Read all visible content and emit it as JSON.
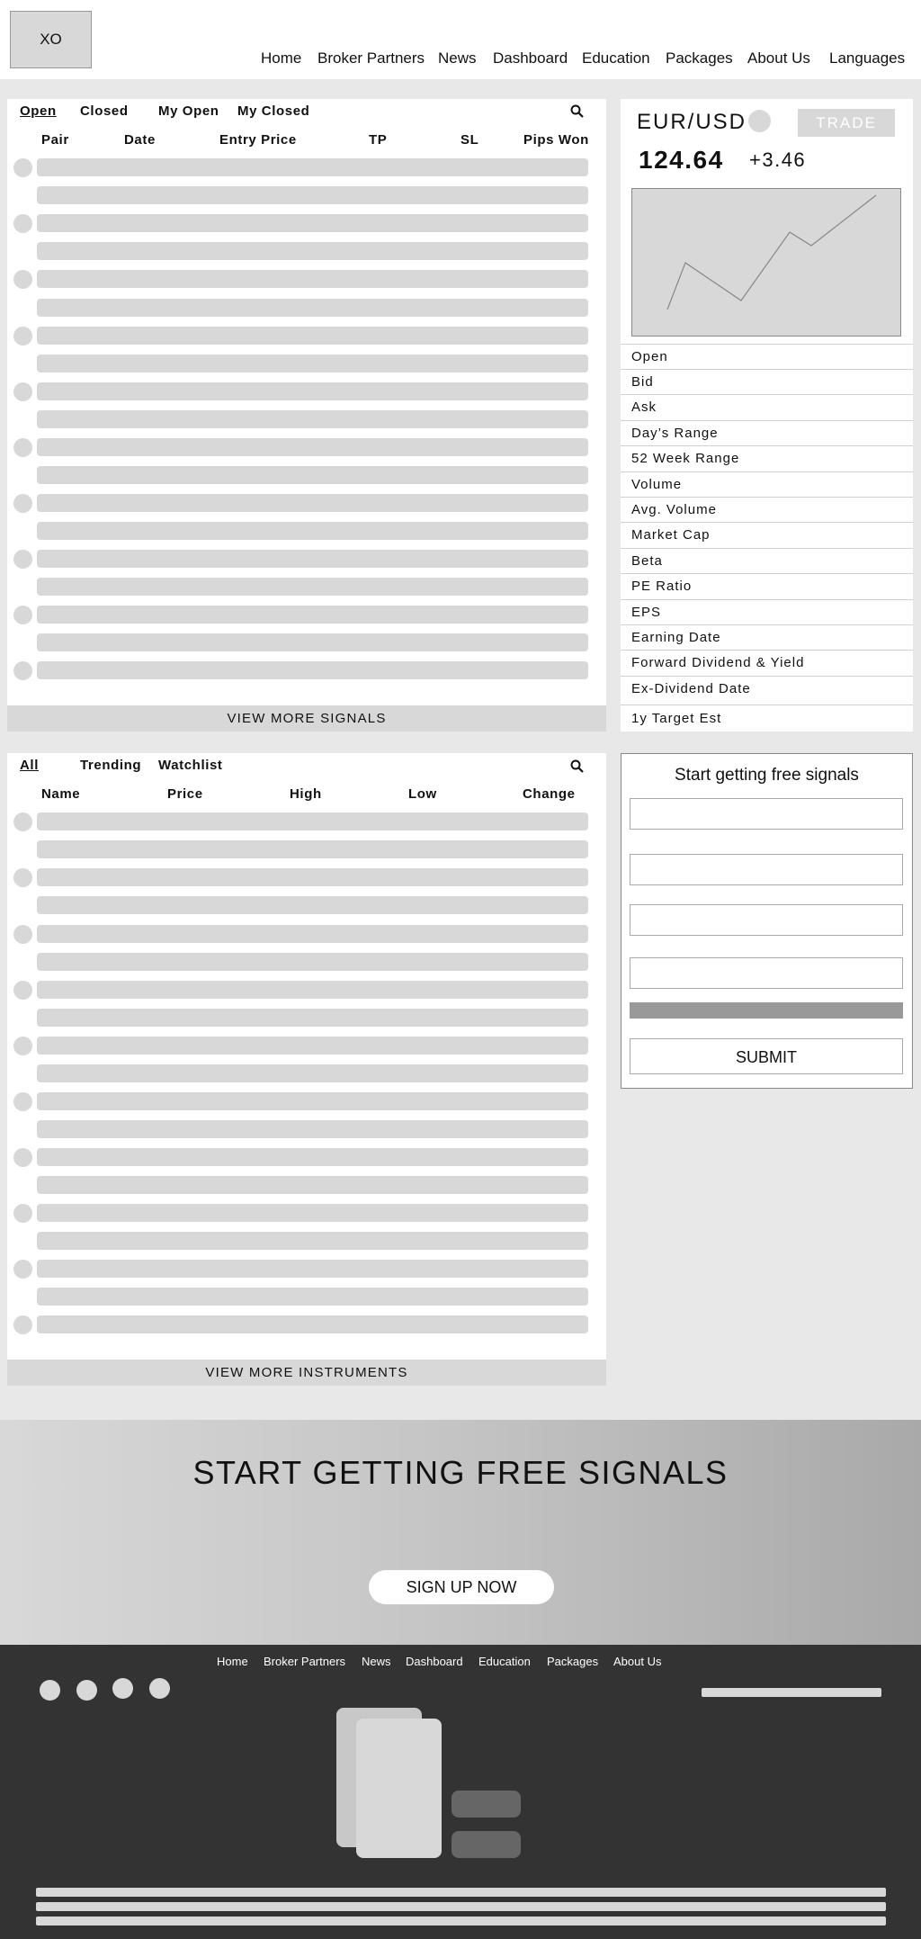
{
  "header": {
    "logo_text": "XO",
    "nav": [
      "Home",
      "Broker Partners",
      "News",
      "Dashboard",
      "Education",
      "Packages",
      "About Us",
      "Languages"
    ]
  },
  "signals_panel": {
    "tabs": [
      "Open",
      "Closed",
      "My Open",
      "My Closed"
    ],
    "active_tab": "Open",
    "columns": [
      "Pair",
      "Date",
      "Entry Price",
      "TP",
      "SL",
      "Pips Won"
    ],
    "more_label": "VIEW MORE SIGNALS"
  },
  "quote_card": {
    "symbol": "EUR/USD",
    "trade_label": "TRADE",
    "price": "124.64",
    "change": "+3.46",
    "stats": [
      "Open",
      "Bid",
      "Ask",
      "Day’s Range",
      "52 Week Range",
      "Volume",
      "Avg. Volume",
      "Market Cap",
      "Beta",
      "PE Ratio",
      "EPS",
      "Earning Date",
      "Forward Dividend & Yield",
      "Ex-Dividend Date",
      "1y Target Est"
    ]
  },
  "instruments_panel": {
    "tabs": [
      "All",
      "Trending",
      "Watchlist"
    ],
    "active_tab": "All",
    "columns": [
      "Name",
      "Price",
      "High",
      "Low",
      "Change"
    ],
    "more_label": "VIEW MORE INSTRUMENTS"
  },
  "signup_form": {
    "title": "Start getting free signals",
    "submit_label": "SUBMIT"
  },
  "cta": {
    "title": "START GETTING FREE SIGNALS",
    "button_label": "SIGN UP NOW"
  },
  "footer": {
    "nav": [
      "Home",
      "Broker Partners",
      "News",
      "Dashboard",
      "Education",
      "Packages",
      "About Us"
    ]
  },
  "icons": {
    "search": "search-icon",
    "social": [
      "social-icon-1",
      "social-icon-2",
      "social-icon-3",
      "social-icon-4"
    ]
  },
  "colors": {
    "placeholder_gray": "#d8d8d8",
    "page_bg": "#e8e8e8",
    "footer_bg": "#333333"
  }
}
